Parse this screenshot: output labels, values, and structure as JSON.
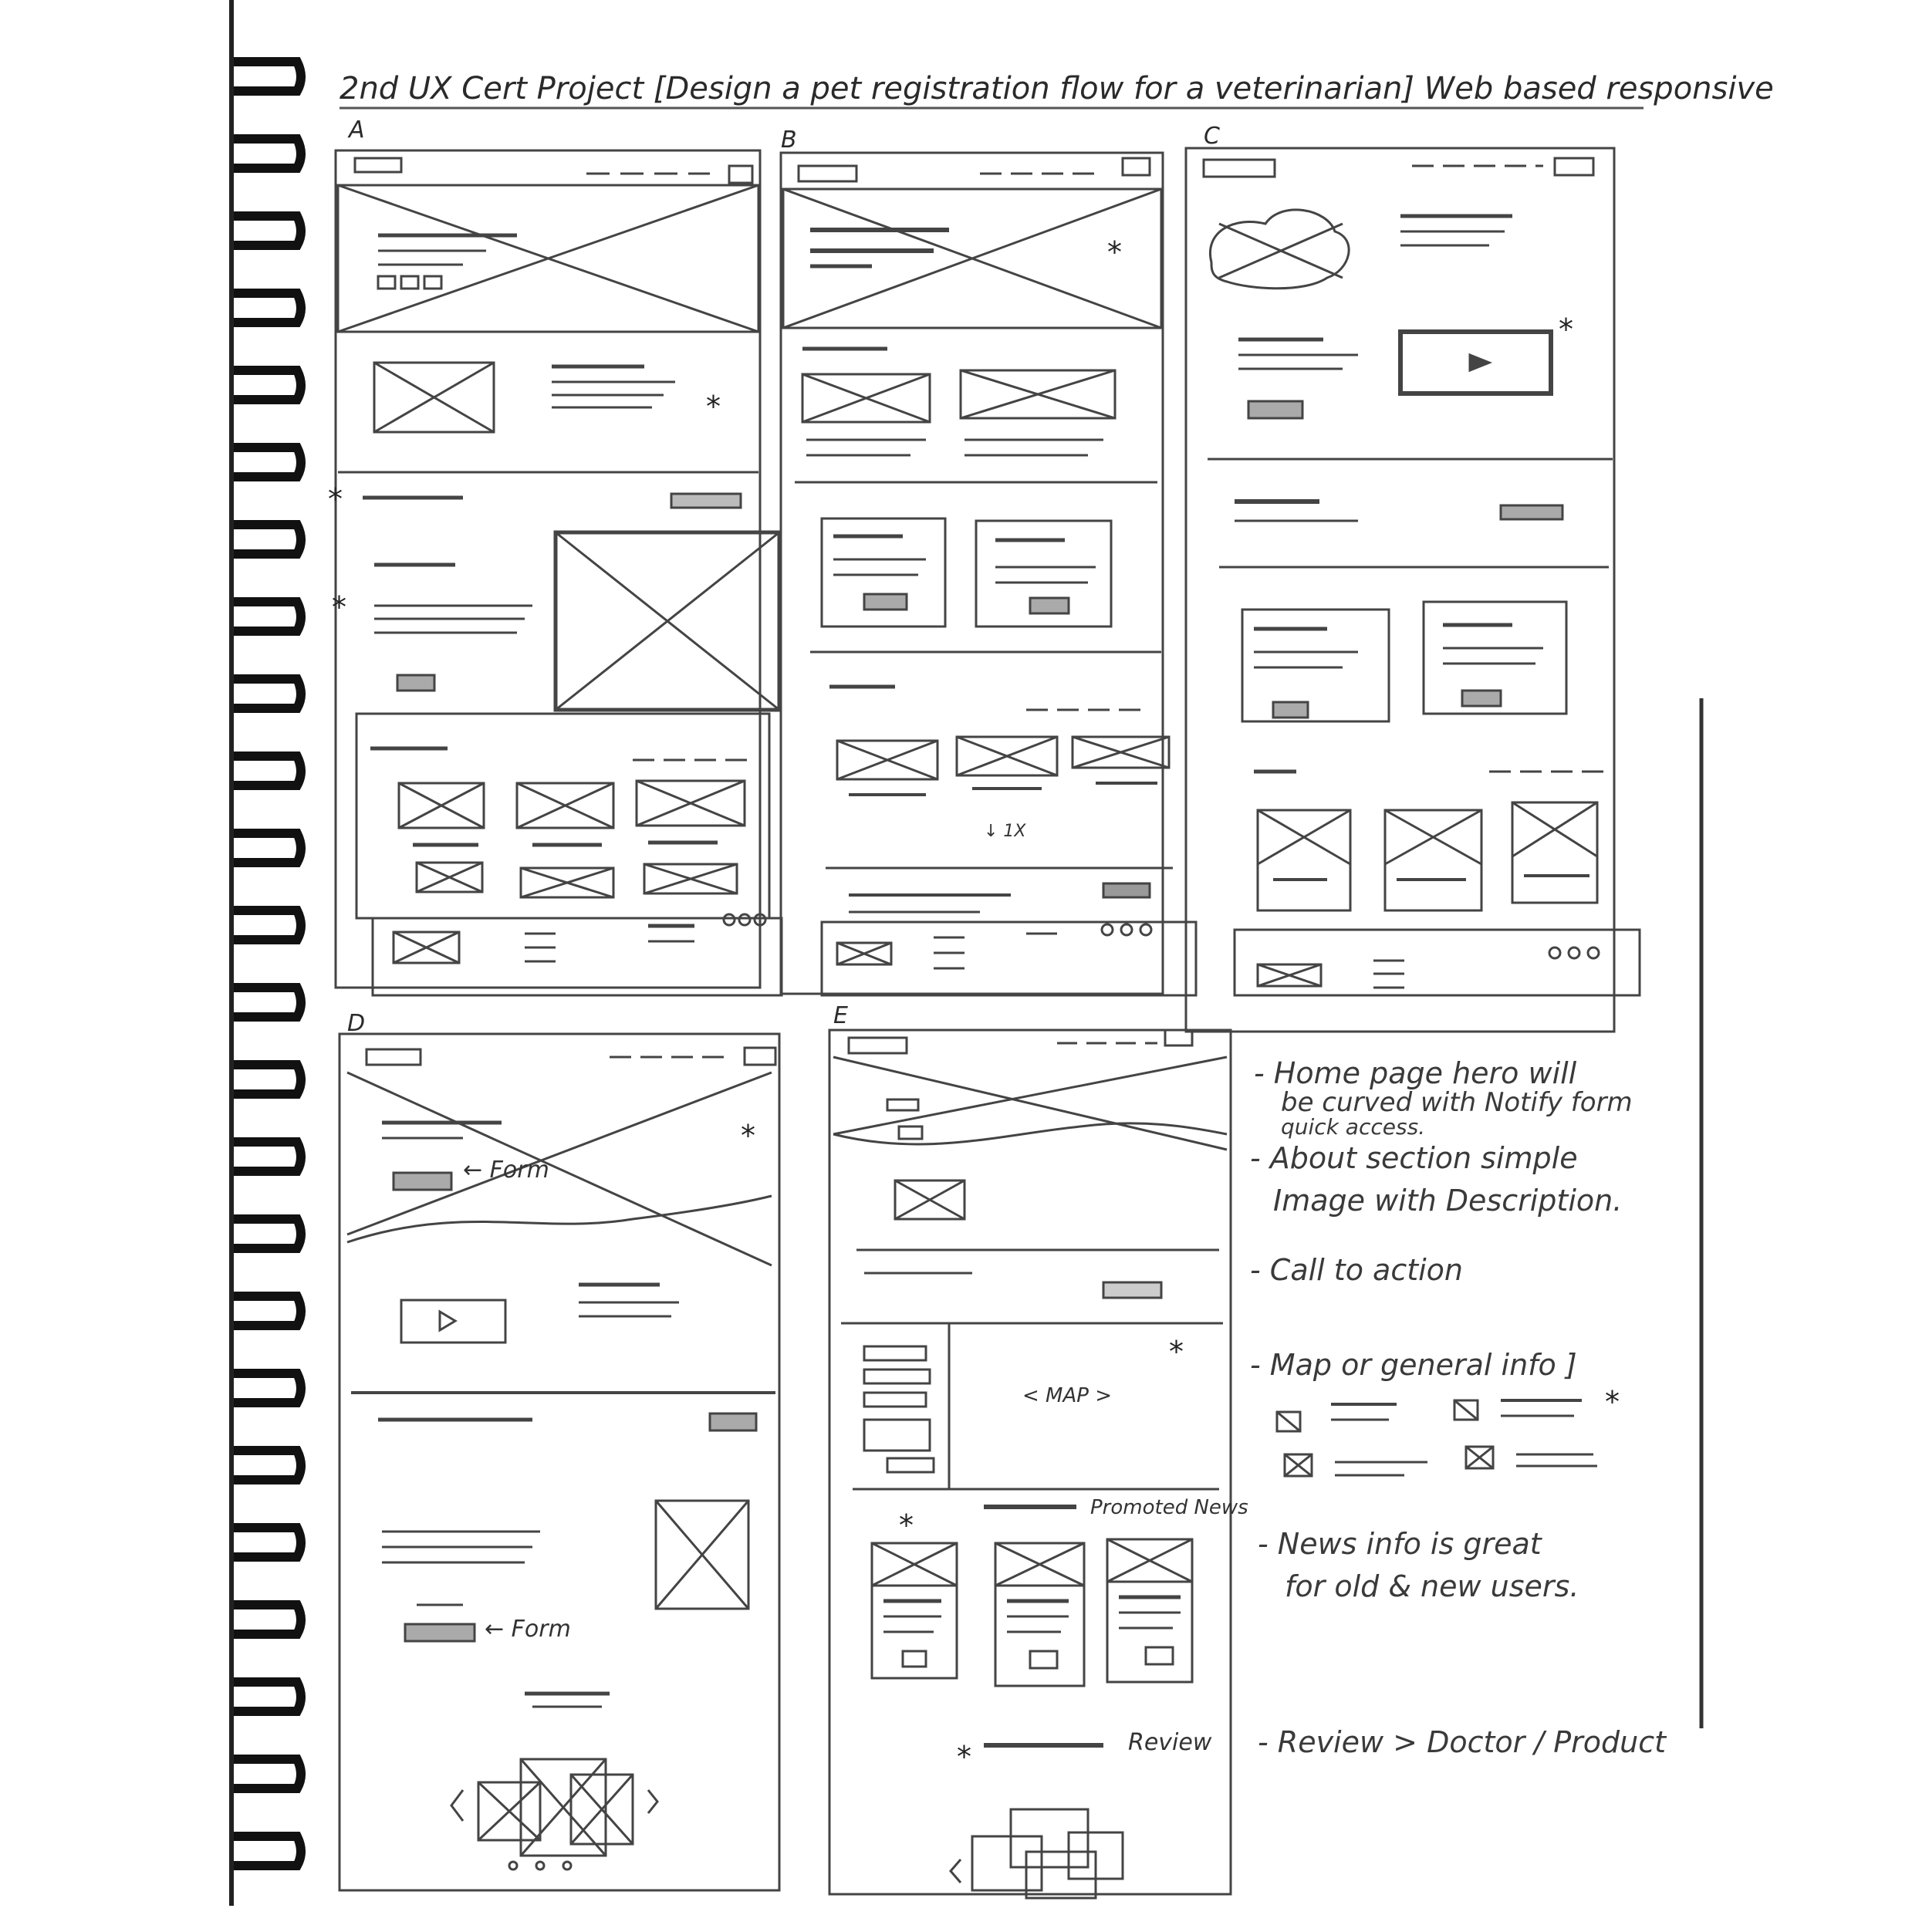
{
  "title": "2nd UX Cert Project [Design a pet registration flow for a veterinarian] Web based responsive",
  "panels": {
    "a": "A",
    "b": "B",
    "c": "C",
    "d": "D",
    "e": "E"
  },
  "annotations": {
    "b_price_sort": "↓ 1X",
    "d_form_1": "← Form",
    "d_form_2": "← Form",
    "e_map": "< MAP >",
    "e_promoted_news": "Promoted News",
    "e_review": "Review"
  },
  "notes": {
    "n1": "- Home page hero will",
    "n1b": "be curved with Notify form",
    "n1c": "quick access.",
    "n2": "- About section simple",
    "n2b": "Image with Description.",
    "n3": "- Call to action",
    "n4": "- Map or general info ]",
    "n5": "- News info is great",
    "n5b": "for old & new users.",
    "n6": "- Review > Doctor / Product"
  }
}
